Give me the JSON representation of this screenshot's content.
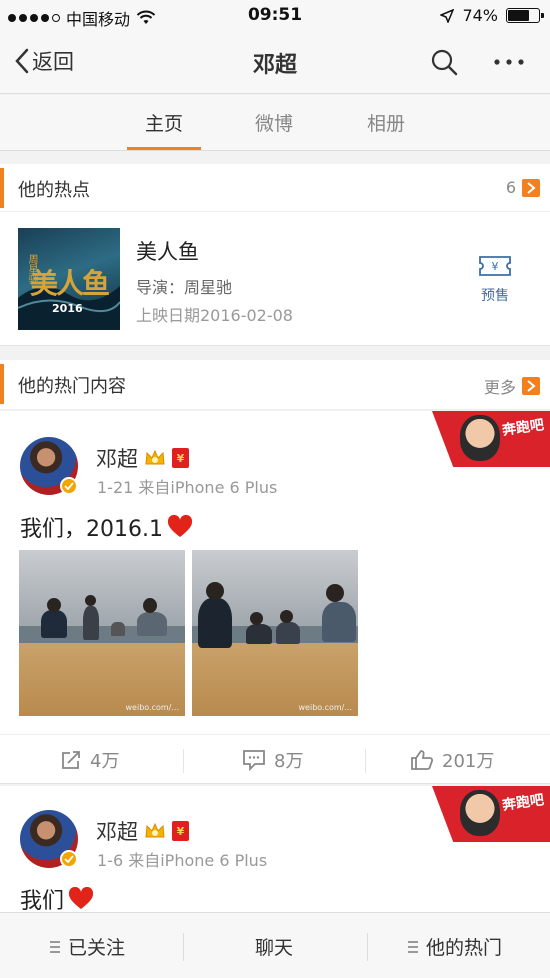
{
  "status_bar": {
    "carrier": "中国移动",
    "time": "09:51",
    "battery_percent": "74%",
    "battery_level": 0.74,
    "icons": [
      "signal-dots-icon",
      "wifi-icon",
      "location-arrow-icon",
      "battery-icon"
    ]
  },
  "nav": {
    "back_label": "返回",
    "title": "邓超",
    "icons": [
      "back-chevron-icon",
      "search-icon",
      "more-icon"
    ]
  },
  "tabs": [
    {
      "label": "主页",
      "active": true
    },
    {
      "label": "微博",
      "active": false
    },
    {
      "label": "相册",
      "active": false
    }
  ],
  "accent_color": "#f08020",
  "hot_section": {
    "title": "他的热点",
    "count": "6",
    "card": {
      "poster_title": "美人鱼",
      "poster_small_text": "周星驰",
      "poster_year": "2016",
      "title": "美人鱼",
      "director": "导演：周星驰",
      "release_date": "上映日期2016-02-08",
      "presale_label": "预售",
      "presale_icon": "ticket-icon"
    }
  },
  "hot_content": {
    "title": "他的热门内容",
    "more_label": "更多",
    "banner_text": "奔跑吧",
    "posts": [
      {
        "author": "邓超",
        "meta": "1-21  来自iPhone 6 Plus",
        "text": "我们，2016.1",
        "watermark": "weibo.com/..."
      },
      {
        "author": "邓超",
        "meta": "1-6  来自iPhone 6 Plus",
        "text": "我们"
      }
    ],
    "actions": {
      "repost": "4万",
      "comment": "8万",
      "like": "201万"
    }
  },
  "bottom_bar": {
    "follow_label": "已关注",
    "chat_label": "聊天",
    "hot_label": "他的热门"
  }
}
